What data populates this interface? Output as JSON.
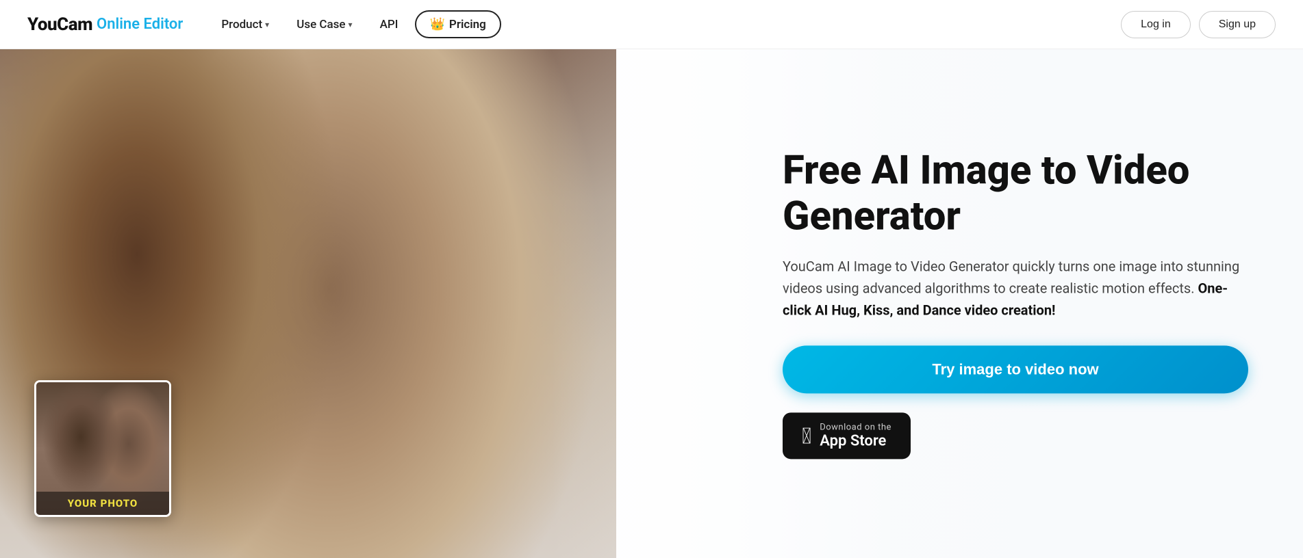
{
  "logo": {
    "youcam": "YouCam",
    "online_editor": "Online Editor"
  },
  "navbar": {
    "product_label": "Product",
    "use_case_label": "Use Case",
    "api_label": "API",
    "pricing_label": "Pricing",
    "crown_icon": "👑",
    "login_label": "Log in",
    "signup_label": "Sign up"
  },
  "hero": {
    "title": "Free AI Image to Video Generator",
    "description_plain": "YouCam AI Image to Video Generator quickly turns one image into stunning videos using advanced algorithms to create realistic motion effects. ",
    "description_bold": "One-click AI Hug, Kiss, and Dance video creation!",
    "cta_label": "Try image to video now",
    "your_photo_label": "YOUR PHOTO",
    "app_store_small": "Download on the",
    "app_store_large": "App Store"
  }
}
